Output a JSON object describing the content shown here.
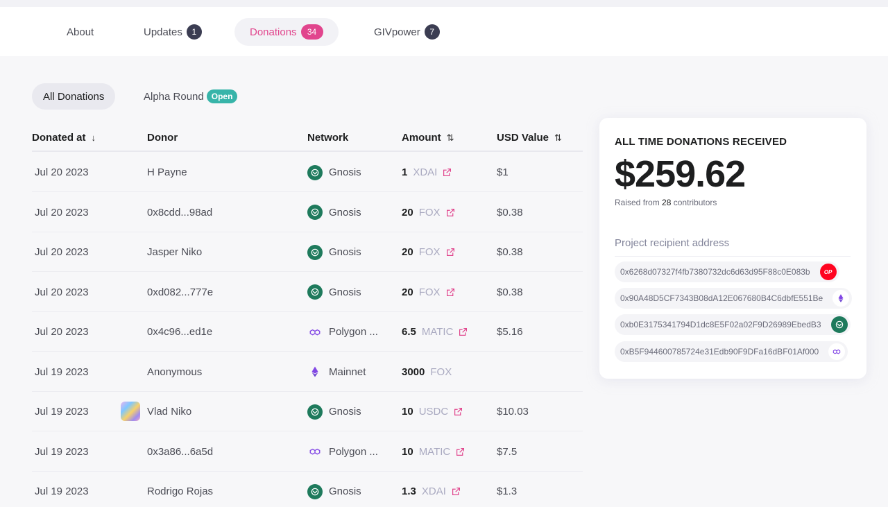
{
  "tabs": [
    {
      "label": "About",
      "badge": null
    },
    {
      "label": "Updates",
      "badge": "1"
    },
    {
      "label": "Donations",
      "badge": "34"
    },
    {
      "label": "GIVpower",
      "badge": "7"
    }
  ],
  "filters": {
    "all": "All Donations",
    "round": "Alpha Round",
    "round_badge": "Open"
  },
  "table": {
    "headers": {
      "date": "Donated at",
      "donor": "Donor",
      "network": "Network",
      "amount": "Amount",
      "usd": "USD Value"
    },
    "rows": [
      {
        "date": "Jul 20 2023",
        "donor": "H Payne",
        "network": "Gnosis",
        "amount": "1",
        "token": "XDAI",
        "usd": "$1"
      },
      {
        "date": "Jul 20 2023",
        "donor": "0x8cdd...98ad",
        "network": "Gnosis",
        "amount": "20",
        "token": "FOX",
        "usd": "$0.38"
      },
      {
        "date": "Jul 20 2023",
        "donor": "Jasper Niko",
        "network": "Gnosis",
        "amount": "20",
        "token": "FOX",
        "usd": "$0.38"
      },
      {
        "date": "Jul 20 2023",
        "donor": "0xd082...777e",
        "network": "Gnosis",
        "amount": "20",
        "token": "FOX",
        "usd": "$0.38"
      },
      {
        "date": "Jul 20 2023",
        "donor": "0x4c96...ed1e",
        "network": "Polygon ...",
        "amount": "6.5",
        "token": "MATIC",
        "usd": "$5.16"
      },
      {
        "date": "Jul 19 2023",
        "donor": "Anonymous",
        "network": "Mainnet",
        "amount": "3000",
        "token": "FOX",
        "usd": ""
      },
      {
        "date": "Jul 19 2023",
        "donor": "Vlad Niko",
        "network": "Gnosis",
        "amount": "10",
        "token": "USDC",
        "usd": "$10.03"
      },
      {
        "date": "Jul 19 2023",
        "donor": "0x3a86...6a5d",
        "network": "Polygon ...",
        "amount": "10",
        "token": "MATIC",
        "usd": "$7.5"
      },
      {
        "date": "Jul 19 2023",
        "donor": "Rodrigo Rojas",
        "network": "Gnosis",
        "amount": "1.3",
        "token": "XDAI",
        "usd": "$1.3"
      }
    ]
  },
  "summary": {
    "title": "ALL TIME DONATIONS RECEIVED",
    "total": "$259.62",
    "raised_prefix": "Raised from",
    "contributors": "28",
    "raised_suffix": "contributors",
    "recipient_label": "Project recipient address",
    "addresses": [
      {
        "address": "0x6268d07327f4fb7380732dc6d63d95F88c0E083b",
        "chain_icon": "optimism-icon",
        "chain_label": "OP"
      },
      {
        "address": "0x90A48D5CF7343B08dA12E067680B4C6dbfE551Be",
        "chain_icon": "ethereum-icon"
      },
      {
        "address": "0xb0E3175341794D1dc8E5F02a02F9D26989EbedB3",
        "chain_icon": "gnosis-icon"
      },
      {
        "address": "0xB5F944600785724e31Edb90F9DFa16dBF01Af000",
        "chain_icon": "polygon-icon"
      }
    ]
  },
  "colors": {
    "accent": "#e1458d",
    "open_badge": "#37b4a9",
    "gnosis": "#1e7a5c",
    "polygon": "#8247e5",
    "optimism": "#ff0420"
  }
}
